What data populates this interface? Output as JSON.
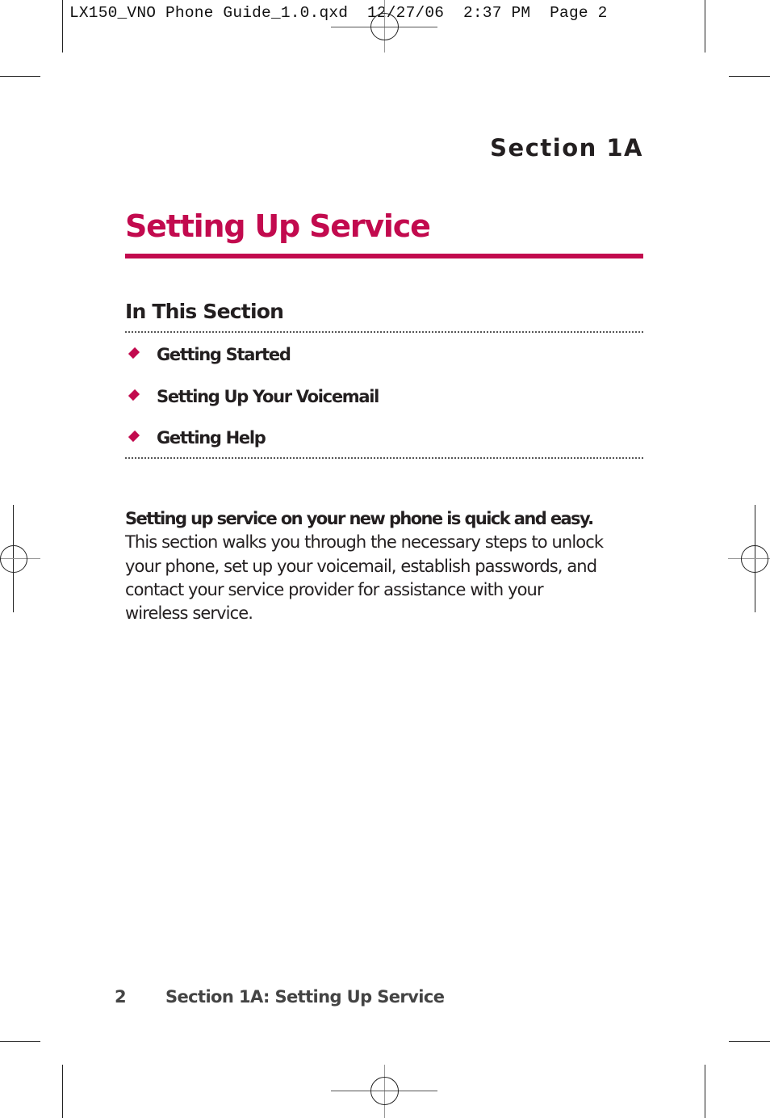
{
  "print_slug": {
    "file": "LX150_VNO Phone Guide_1.0.qxd",
    "date": "12/27/06",
    "time": "2:37 PM",
    "page": "Page 2"
  },
  "colors": {
    "accent": "#C20A4E",
    "text": "#231F20",
    "footer_text": "#444444"
  },
  "header": {
    "section_label": "Section 1A",
    "title": "Setting Up Service"
  },
  "in_this_section": {
    "heading": "In This Section",
    "items": [
      {
        "label": "Getting Started",
        "icon": "diamond-bullet-icon"
      },
      {
        "label": "Setting Up Your Voicemail",
        "icon": "diamond-bullet-icon"
      },
      {
        "label": "Getting Help",
        "icon": "diamond-bullet-icon"
      }
    ]
  },
  "intro": {
    "lead": "Setting up service on your new phone is quick and easy.",
    "body": "This section walks you through the necessary steps to unlock your phone, set up your voicemail, establish passwords, and contact your service provider for assistance with your wireless service."
  },
  "footer": {
    "page_number": "2",
    "running_title": "Section 1A: Setting Up Service"
  }
}
